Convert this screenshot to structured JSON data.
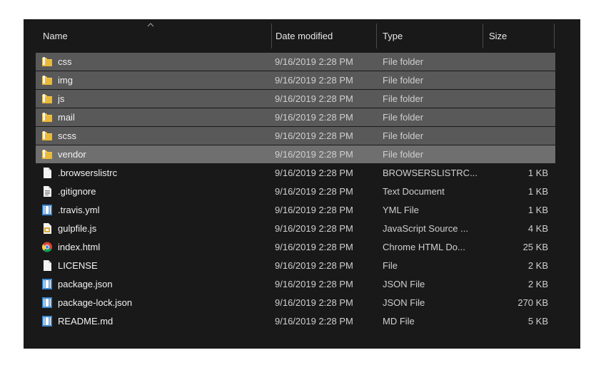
{
  "columns": {
    "name": "Name",
    "date": "Date modified",
    "type": "Type",
    "size": "Size"
  },
  "sort": {
    "column": "name",
    "icon": "sort-ascending-caret-icon"
  },
  "files": [
    {
      "name": "css",
      "date": "9/16/2019 2:28 PM",
      "type": "File folder",
      "size": "",
      "icon": "folder",
      "selected": true
    },
    {
      "name": "img",
      "date": "9/16/2019 2:28 PM",
      "type": "File folder",
      "size": "",
      "icon": "folder",
      "selected": true
    },
    {
      "name": "js",
      "date": "9/16/2019 2:28 PM",
      "type": "File folder",
      "size": "",
      "icon": "folder",
      "selected": true
    },
    {
      "name": "mail",
      "date": "9/16/2019 2:28 PM",
      "type": "File folder",
      "size": "",
      "icon": "folder",
      "selected": true
    },
    {
      "name": "scss",
      "date": "9/16/2019 2:28 PM",
      "type": "File folder",
      "size": "",
      "icon": "folder",
      "selected": true
    },
    {
      "name": "vendor",
      "date": "9/16/2019 2:28 PM",
      "type": "File folder",
      "size": "",
      "icon": "folder",
      "selected": true,
      "focused": true
    },
    {
      "name": ".browserslistrc",
      "date": "9/16/2019 2:28 PM",
      "type": "BROWSERSLISTRC...",
      "size": "1 KB",
      "icon": "blank-file",
      "selected": false
    },
    {
      "name": ".gitignore",
      "date": "9/16/2019 2:28 PM",
      "type": "Text Document",
      "size": "1 KB",
      "icon": "text-file",
      "selected": false
    },
    {
      "name": ".travis.yml",
      "date": "9/16/2019 2:28 PM",
      "type": "YML File",
      "size": "1 KB",
      "icon": "code-file",
      "selected": false
    },
    {
      "name": "gulpfile.js",
      "date": "9/16/2019 2:28 PM",
      "type": "JavaScript Source ...",
      "size": "4 KB",
      "icon": "js-file",
      "selected": false
    },
    {
      "name": "index.html",
      "date": "9/16/2019 2:28 PM",
      "type": "Chrome HTML Do...",
      "size": "25 KB",
      "icon": "chrome-file",
      "selected": false
    },
    {
      "name": "LICENSE",
      "date": "9/16/2019 2:28 PM",
      "type": "File",
      "size": "2 KB",
      "icon": "blank-file",
      "selected": false
    },
    {
      "name": "package.json",
      "date": "9/16/2019 2:28 PM",
      "type": "JSON File",
      "size": "2 KB",
      "icon": "code-file",
      "selected": false
    },
    {
      "name": "package-lock.json",
      "date": "9/16/2019 2:28 PM",
      "type": "JSON File",
      "size": "270 KB",
      "icon": "code-file",
      "selected": false
    },
    {
      "name": "README.md",
      "date": "9/16/2019 2:28 PM",
      "type": "MD File",
      "size": "5 KB",
      "icon": "code-file",
      "selected": false
    }
  ],
  "colors": {
    "background": "#191919",
    "selection": "#595959",
    "focused_selection": "#6f6f6f",
    "folder": "#f3c94f",
    "code_icon": "#3c89d0"
  }
}
